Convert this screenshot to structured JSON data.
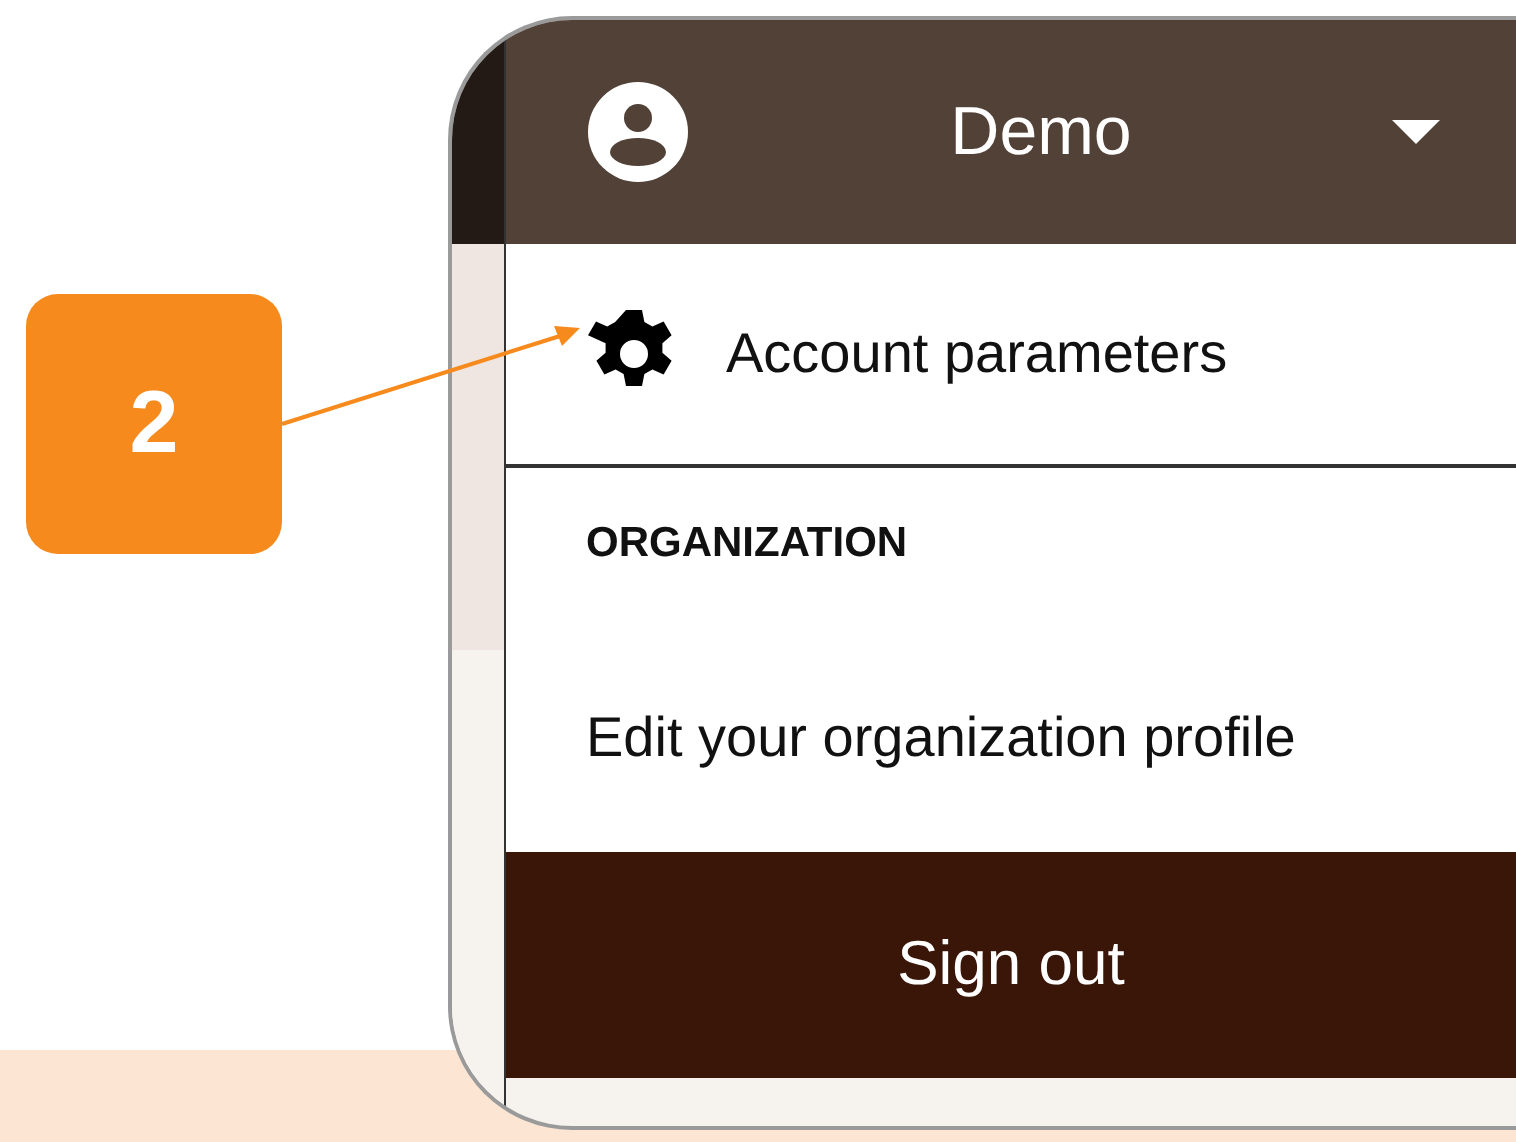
{
  "callout": {
    "number": "2"
  },
  "menu": {
    "user": "Demo",
    "items": [
      {
        "kind": "gear-link",
        "label": "Account parameters"
      },
      {
        "kind": "heading",
        "label": "ORGANIZATION"
      },
      {
        "kind": "link",
        "label": "Edit your organization profile"
      },
      {
        "kind": "signout",
        "label": "Sign out"
      }
    ]
  }
}
